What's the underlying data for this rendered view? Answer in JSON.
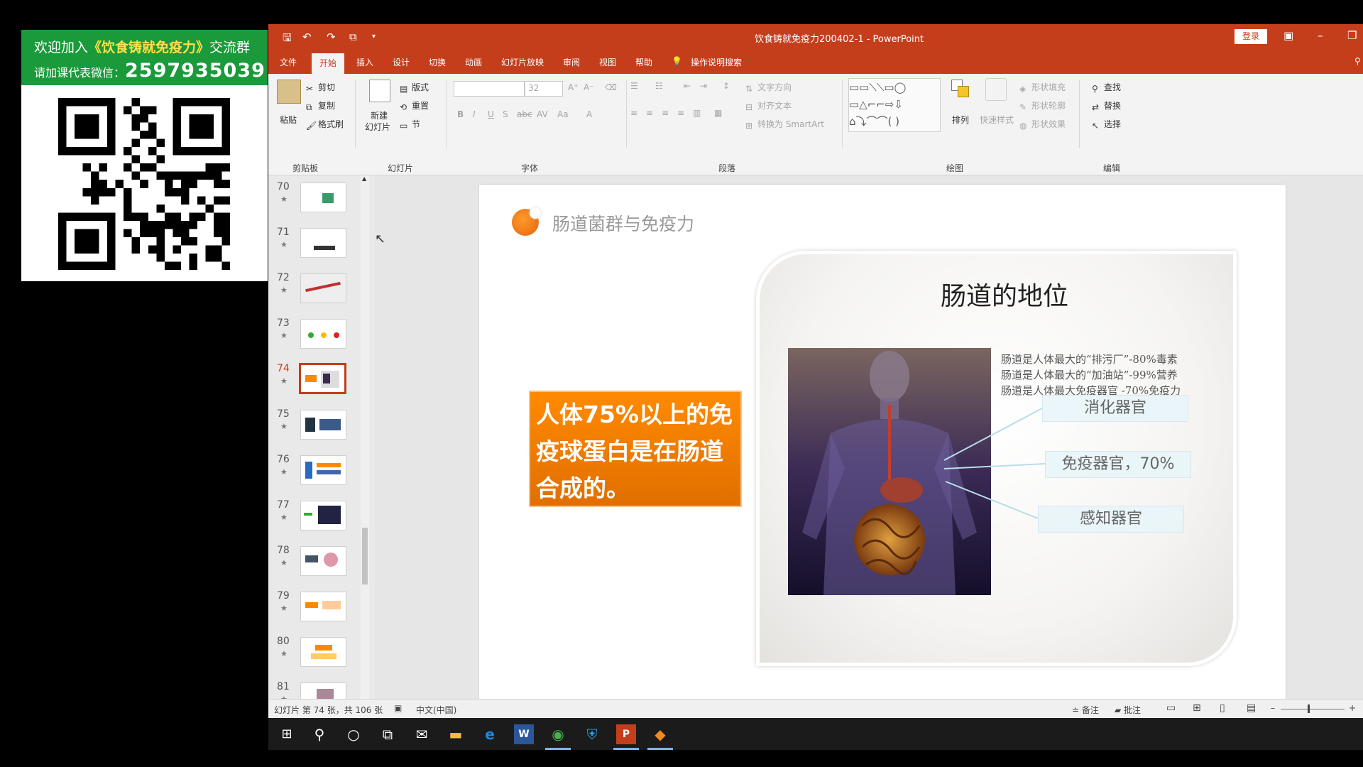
{
  "wechat": {
    "line1_prefix": "欢迎加入",
    "line1_highlight": "《饮食铸就免疫力》",
    "line1_suffix": "交流群",
    "line2_prefix": "请加课代表微信：",
    "line2_number": "2597935039"
  },
  "titlebar": {
    "doc_title": "饮食铸就免疫力200402-1  -  PowerPoint",
    "login": "登录"
  },
  "tabs": [
    "文件",
    "开始",
    "插入",
    "设计",
    "切换",
    "动画",
    "幻灯片放映",
    "审阅",
    "视图",
    "帮助"
  ],
  "active_tab": "开始",
  "tell_me": "操作说明搜索",
  "ribbon": {
    "clipboard": {
      "paste": "粘贴",
      "cut": "剪切",
      "copy": "复制",
      "format_painter": "格式刷",
      "label": "剪贴板"
    },
    "slides": {
      "new_slide_1": "新建",
      "new_slide_2": "幻灯片",
      "layout": "版式",
      "reset": "重置",
      "section": "节",
      "label": "幻灯片"
    },
    "font": {
      "font_size": "32",
      "label": "字体"
    },
    "paragraph": {
      "text_direction": "文字方向",
      "align_text": "对齐文本",
      "smartart": "转换为 SmartArt",
      "label": "段落"
    },
    "drawing": {
      "arrange": "排列",
      "quick_styles": "快速样式",
      "fill": "形状填充",
      "outline": "形状轮廓",
      "effects": "形状效果",
      "label": "绘图"
    },
    "editing": {
      "find": "查找",
      "replace": "替换",
      "select": "选择",
      "label": "编辑"
    }
  },
  "thumbnails": [
    {
      "num": "70",
      "star": "★"
    },
    {
      "num": "71",
      "star": "★"
    },
    {
      "num": "72",
      "star": "★"
    },
    {
      "num": "73",
      "star": "★"
    },
    {
      "num": "74",
      "star": "★"
    },
    {
      "num": "75",
      "star": "★"
    },
    {
      "num": "76",
      "star": "★"
    },
    {
      "num": "77",
      "star": "★"
    },
    {
      "num": "78",
      "star": "★"
    },
    {
      "num": "79",
      "star": "★"
    },
    {
      "num": "80",
      "star": "★"
    },
    {
      "num": "81",
      "star": "★"
    }
  ],
  "selected_slide": "74",
  "slide": {
    "title": "肠道菌群与免疫力",
    "orange_text": "人体75%以上的免疫球蛋白是在肠道合成的。",
    "card_title": "肠道的地位",
    "statements": [
      "肠道是人体最大的“排污厂”-80%毒素",
      "肠道是人体最大的“加油站”-99%营养",
      "肠道是人体最大免疫器官   -70%免疫力"
    ],
    "labels": [
      "消化器官",
      "免疫器官，70%",
      "感知器官"
    ]
  },
  "statusbar": {
    "slide_info": "幻灯片 第 74 张，共 106 张",
    "language": "中文(中国)",
    "notes": "备注",
    "comments": "批注"
  },
  "colors": {
    "ppt_accent": "#c43e1c",
    "wechat_green": "#1a9a3a",
    "orange": "#ff8a00"
  }
}
